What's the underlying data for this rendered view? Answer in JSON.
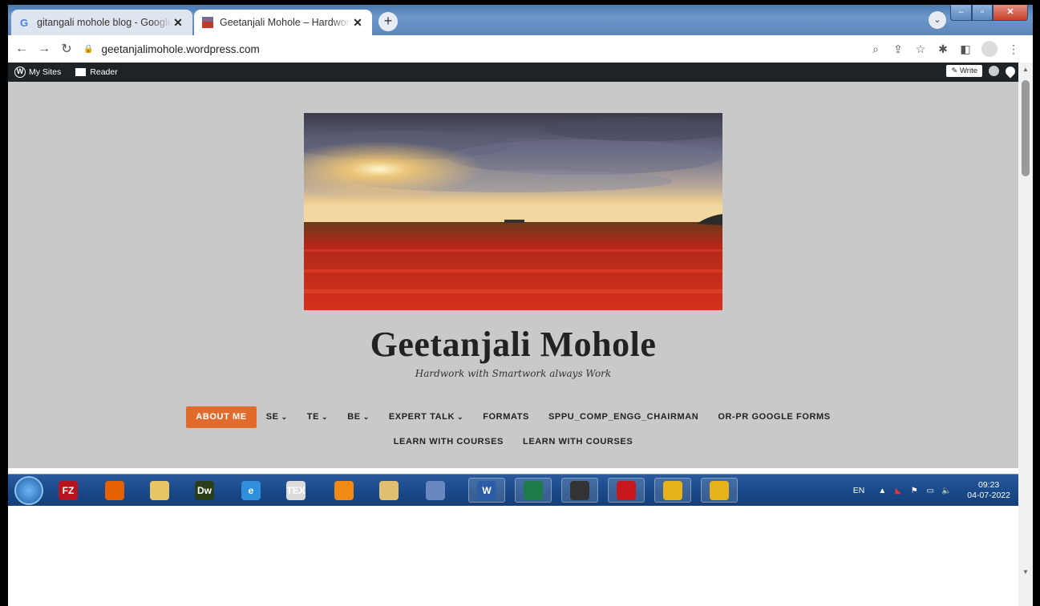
{
  "browser": {
    "tabs": [
      {
        "title": "gitangali mohole blog - Google S",
        "active": false
      },
      {
        "title": "Geetanjali Mohole – Hardwork w",
        "active": true
      }
    ],
    "new_tab_label": "+",
    "address": "geetanjalimohole.wordpress.com"
  },
  "wp_admin_bar": {
    "my_sites": "My Sites",
    "reader": "Reader",
    "write": "Write"
  },
  "site": {
    "title": "Geetanjali Mohole",
    "tagline": "Hardwork with Smartwork always Work",
    "menu_row1": [
      {
        "label": "ABOUT ME",
        "dropdown": false,
        "highlight": true
      },
      {
        "label": "SE",
        "dropdown": true,
        "highlight": false
      },
      {
        "label": "TE",
        "dropdown": true,
        "highlight": false
      },
      {
        "label": "BE",
        "dropdown": true,
        "highlight": false
      },
      {
        "label": "EXPERT TALK",
        "dropdown": true,
        "highlight": false
      },
      {
        "label": "FORMATS",
        "dropdown": false,
        "highlight": false
      },
      {
        "label": "SPPU_COMP_ENGG_CHAIRMAN",
        "dropdown": false,
        "highlight": false
      },
      {
        "label": "OR-PR GOOGLE FORMS",
        "dropdown": false,
        "highlight": false
      }
    ],
    "menu_row2": [
      {
        "label": "LEARN WITH COURSES"
      },
      {
        "label": "LEARN WITH COURSES"
      }
    ],
    "accent_color": "#e16b2d"
  },
  "taskbar": {
    "apps": [
      {
        "icon": "filezilla-icon",
        "text": "FZ",
        "color": "#b8141e"
      },
      {
        "icon": "firefox-icon",
        "text": "",
        "color": "#e66000"
      },
      {
        "icon": "file-explorer-icon",
        "text": "",
        "color": "#e8c666"
      },
      {
        "icon": "dreamweaver-icon",
        "text": "Dw",
        "color": "#2a3e1a"
      },
      {
        "icon": "internet-explorer-icon",
        "text": "e",
        "color": "#2f8fdc"
      },
      {
        "icon": "tex-icon",
        "text": "TEX",
        "color": "#dcdcdc"
      },
      {
        "icon": "vlc-icon",
        "text": "",
        "color": "#f08a12"
      },
      {
        "icon": "paint-icon",
        "text": "",
        "color": "#e0c070"
      },
      {
        "icon": "snipping-tool-icon",
        "text": "",
        "color": "#6a88c0"
      },
      {
        "icon": "word-icon",
        "text": "W",
        "color": "#2a5ca8"
      },
      {
        "icon": "network-icon",
        "text": "",
        "color": "#1f7a4a"
      },
      {
        "icon": "apple-icon",
        "text": "",
        "color": "#333"
      },
      {
        "icon": "acrobat-icon",
        "text": "",
        "color": "#c8161d"
      },
      {
        "icon": "chrome-icon",
        "text": "",
        "color": "#e8b31a"
      },
      {
        "icon": "chrome-icon-2",
        "text": "",
        "color": "#e8b31a"
      }
    ],
    "language": "EN",
    "time": "09:23",
    "date": "04-07-2022"
  }
}
